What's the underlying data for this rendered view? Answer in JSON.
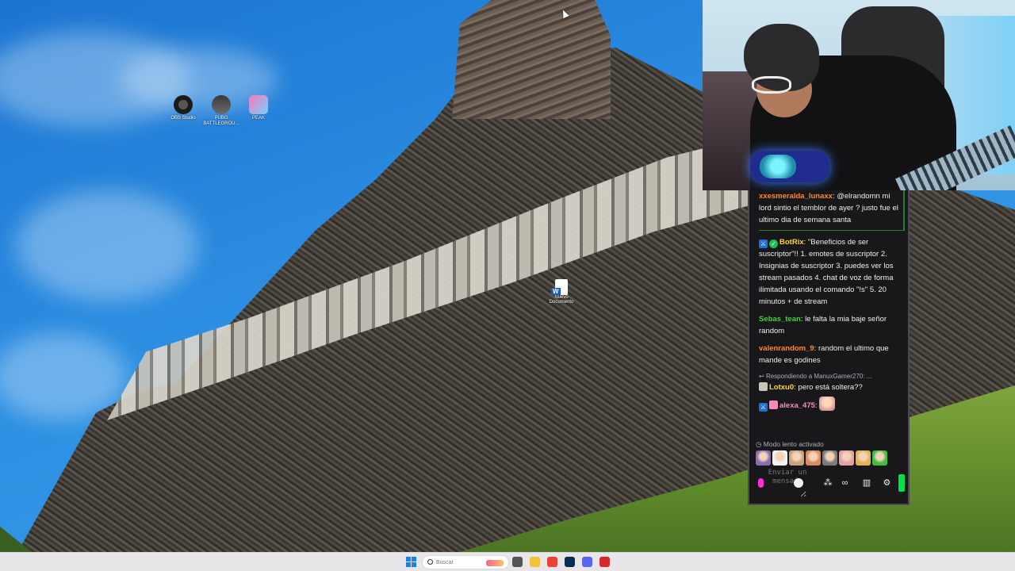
{
  "desktop": {
    "icons": [
      {
        "label": "OBS Studio",
        "icon": "obs-icon"
      },
      {
        "label": "PUBG BATTLEGROU...",
        "icon": "pubg-icon"
      },
      {
        "label": "PEAK",
        "icon": "peak-icon"
      }
    ],
    "document_icon": {
      "label": "Nuevo Documento",
      "icon": "word-document-icon"
    }
  },
  "chat": {
    "messages": [
      {
        "user": "xxesmeralda_lunaxx",
        "user_color": "#ff8a2b",
        "text": ": @elrandomn mi lord sintio el temblor de ayer ? justo fue el ultimo dia de semana santa",
        "badges": []
      },
      {
        "user": "BotRix",
        "user_color": "#ffd43b",
        "text": ": \"Beneficios de ser suscriptor\"!! 1. emotes de suscriptor 2. Insignias de suscriptor 3. puedes ver los stream pasados 4. chat de voz de forma ilimitada usando el comando \"!s\" 5. 20 minutos + de stream",
        "badges": [
          "sword-badge-icon",
          "verified-badge-icon"
        ]
      },
      {
        "user": "Sebas_tean",
        "user_color": "#3ed23e",
        "text": ": le falta la mia baje señor random",
        "badges": []
      },
      {
        "user": "valenrandom_9",
        "user_color": "#ff8a2b",
        "text": ": random el ultimo que mande es godines",
        "badges": []
      }
    ],
    "reply": {
      "hint": "Respondiendo a ManuxGamer270: ...",
      "user": "Lotxu0",
      "user_color": "#ffd43b",
      "text": ": pero está soltera??"
    },
    "last_message": {
      "user": "alexa_475",
      "user_color": "#f58cbc",
      "text": ":"
    },
    "slow_mode": "Modo lento activado",
    "emote_bar": [
      "#8a6bb5",
      "#f2f2f2",
      "#c9a27a",
      "#d98a5f",
      "#7a7a7a",
      "#e0a3a3",
      "#e6b04f",
      "#3fbf3f"
    ],
    "input": {
      "placeholder": "Enviar un mensaje"
    },
    "send_color": "#00e04b"
  },
  "taskbar": {
    "search_placeholder": "Buscar",
    "apps": [
      {
        "name": "file-manager-icon",
        "color": "#555555"
      },
      {
        "name": "folder-icon",
        "color": "#f3c23b"
      },
      {
        "name": "chrome-icon",
        "color": "#e84335"
      },
      {
        "name": "photoshop-icon",
        "color": "#0a2b55"
      },
      {
        "name": "discord-icon",
        "color": "#5865f2"
      },
      {
        "name": "game-icon",
        "color": "#d62828"
      }
    ]
  }
}
